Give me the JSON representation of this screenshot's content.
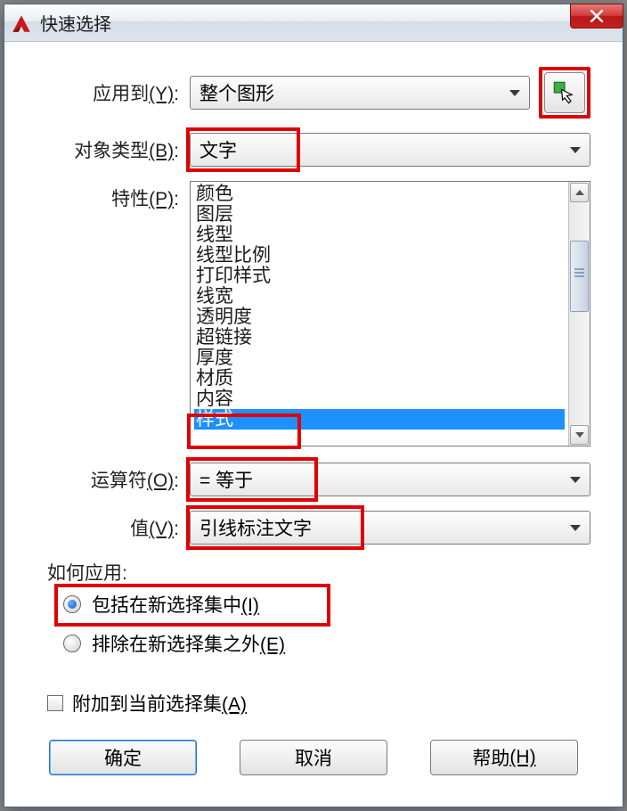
{
  "window": {
    "title": "快速选择"
  },
  "labels": {
    "applyTo": "应用到",
    "applyToKey": "(Y)",
    "objectType": "对象类型",
    "objectTypeKey": "(B)",
    "properties": "特性",
    "propertiesKey": "(P)",
    "operator": "运算符",
    "operatorKey": "(O)",
    "value": "值",
    "valueKey": "(V)",
    "howApply": "如何应用:",
    "radioInclude": "包括在新选择集中",
    "radioIncludeKey": "(I)",
    "radioExclude": "排除在新选择集之外",
    "radioExcludeKey": "(E)",
    "appendCheck": "附加到当前选择集",
    "appendCheckKey": "(A)"
  },
  "dropdowns": {
    "applyTo": "整个图形",
    "objectType": "文字",
    "operator": "= 等于",
    "value": "引线标注文字"
  },
  "propertyList": [
    "颜色",
    "图层",
    "线型",
    "线型比例",
    "打印样式",
    "线宽",
    "透明度",
    "超链接",
    "厚度",
    "材质",
    "内容",
    "样式"
  ],
  "selectedProperty": "样式",
  "buttons": {
    "ok": "确定",
    "cancel": "取消",
    "help": "帮助",
    "helpKey": "(H)"
  }
}
